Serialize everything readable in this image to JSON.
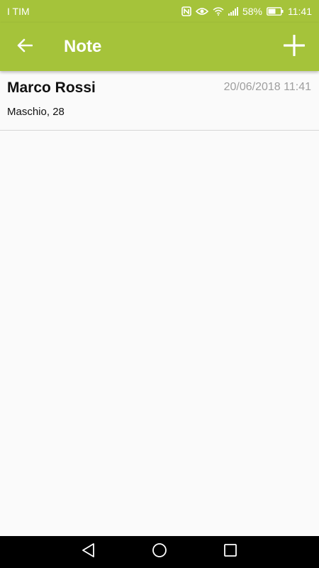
{
  "colors": {
    "accent": "#a5c33a",
    "background": "#fafafa",
    "date_text": "#9e9e9e",
    "nav_bar": "#000000"
  },
  "status_bar": {
    "carrier": "I TIM",
    "battery_percent": "58%",
    "time": "11:41",
    "icons": [
      "nfc-icon",
      "eye-icon",
      "wifi-icon",
      "signal-icon",
      "battery-icon"
    ]
  },
  "app_bar": {
    "title": "Note",
    "back_icon": "arrow-back-icon",
    "add_icon": "plus-icon"
  },
  "notes": [
    {
      "name": "Marco Rossi",
      "datetime": "20/06/2018 11:41",
      "details": "Maschio, 28"
    }
  ],
  "nav_bar": {
    "icons": [
      "back-triangle-icon",
      "home-circle-icon",
      "recents-square-icon"
    ]
  }
}
